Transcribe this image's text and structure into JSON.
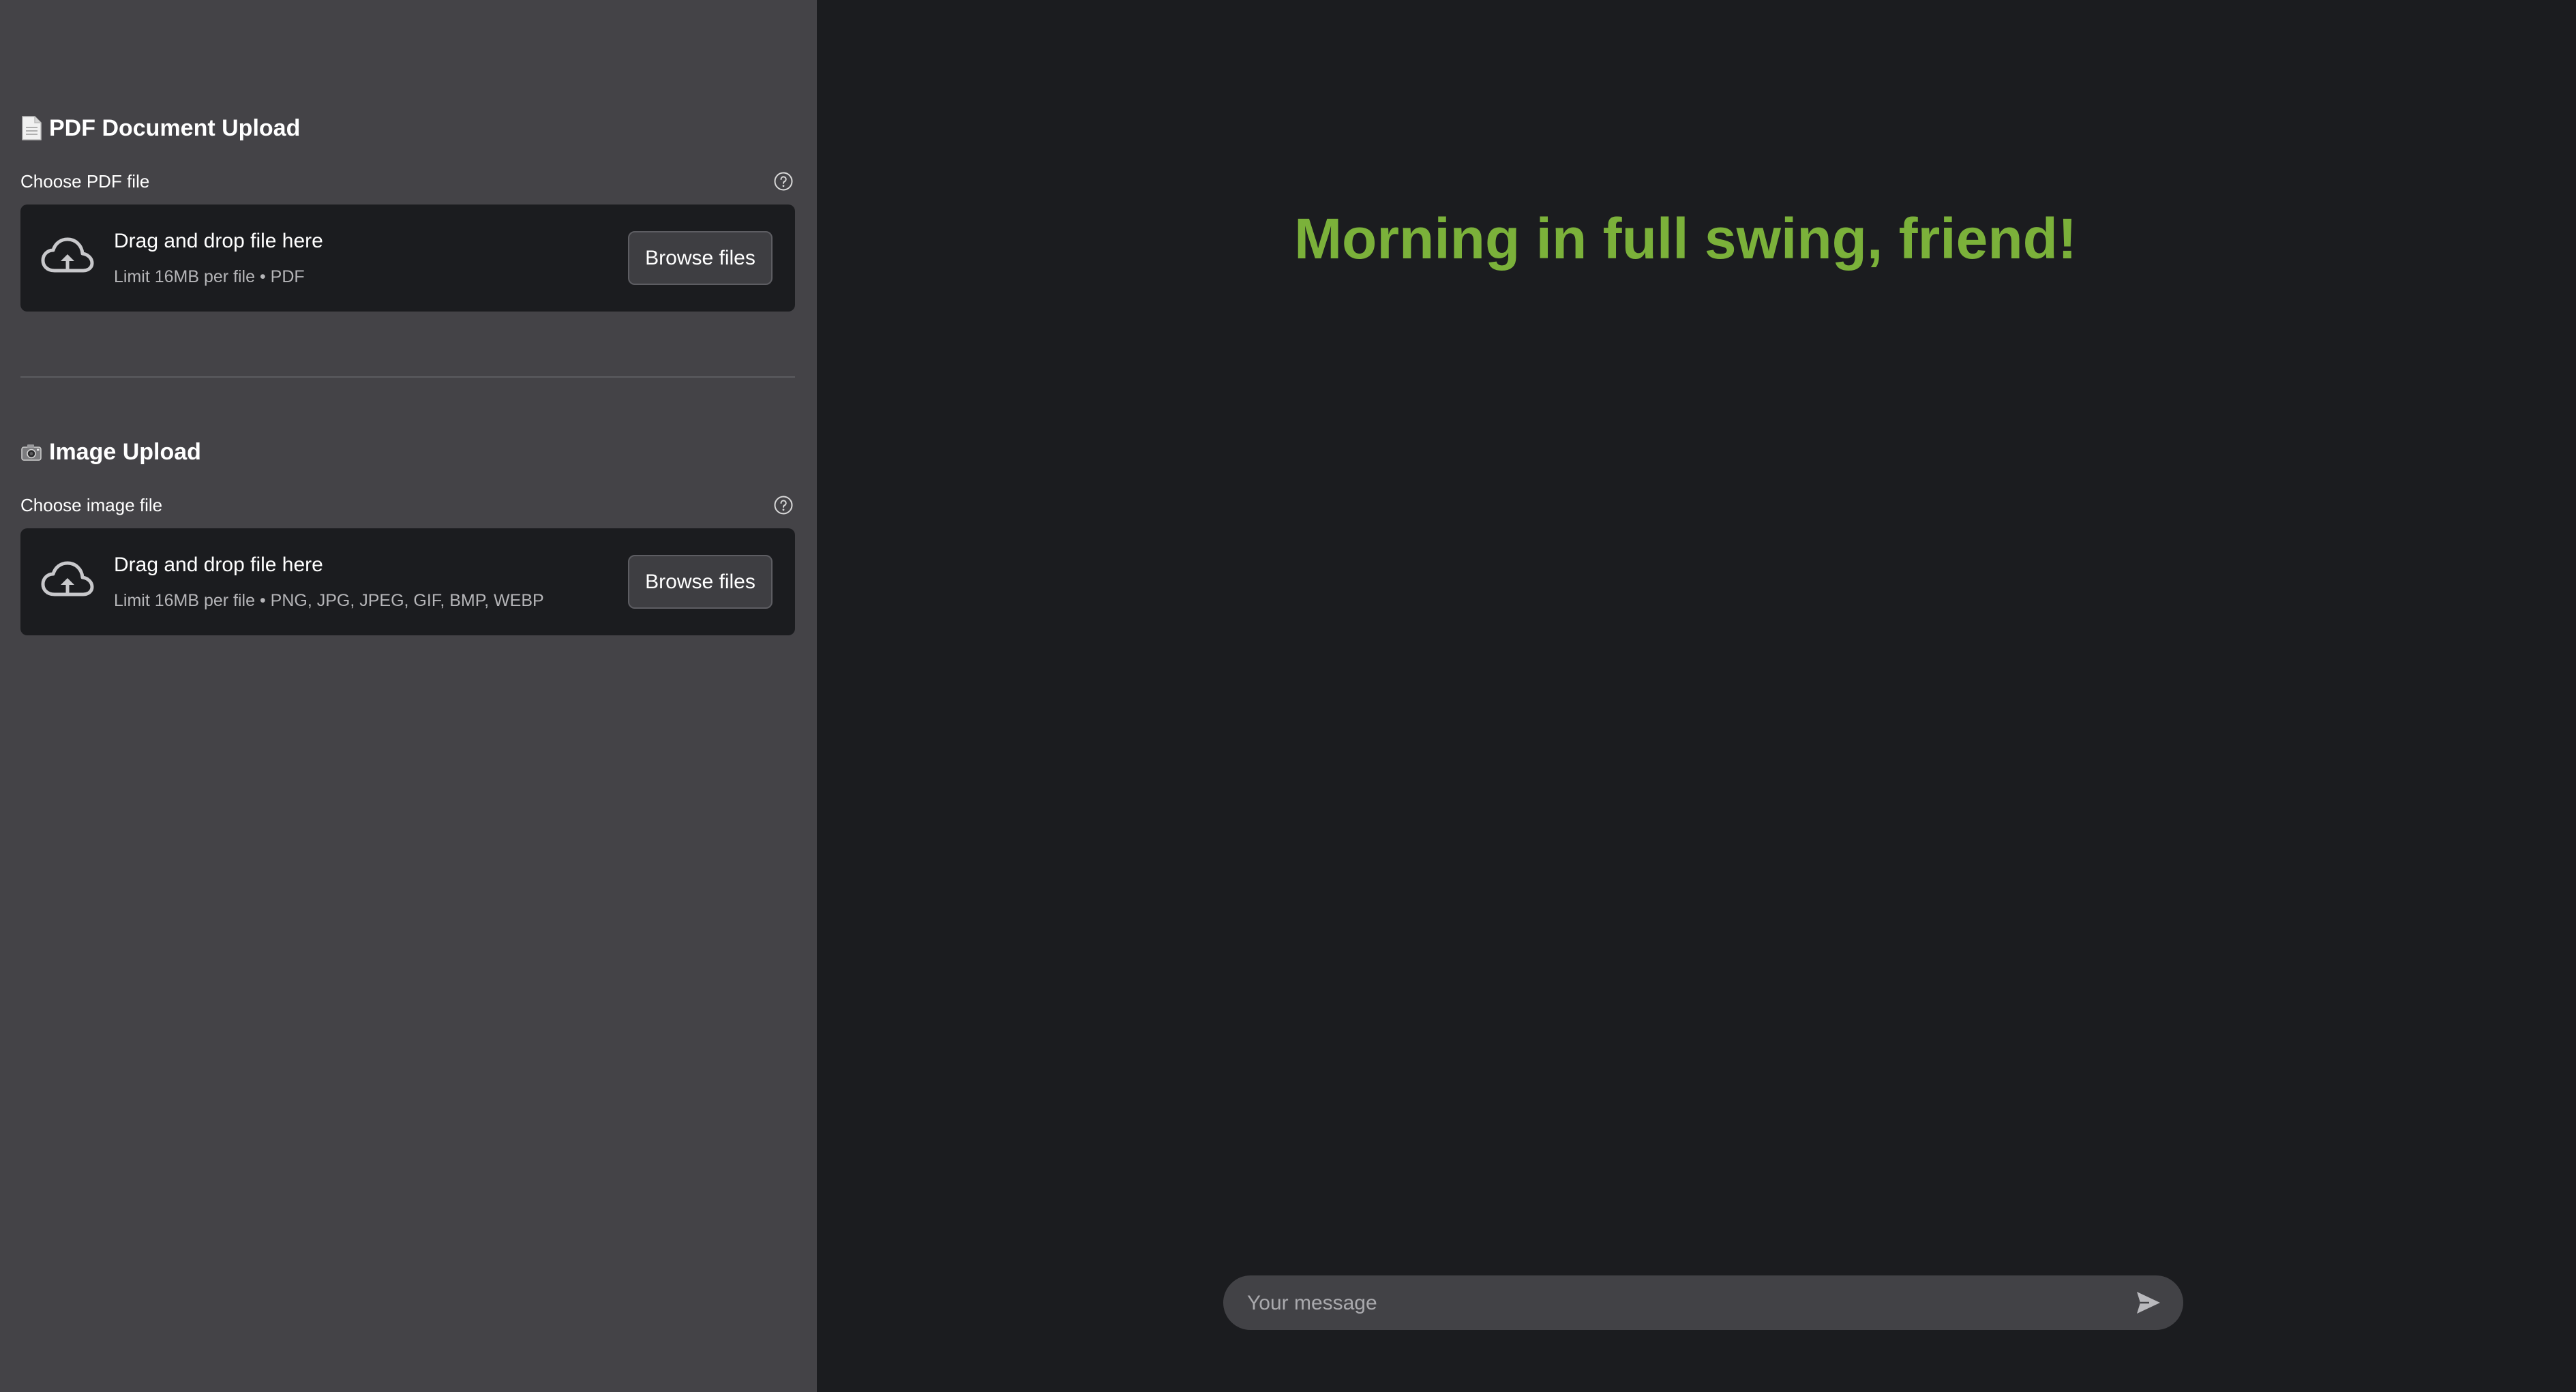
{
  "sidebar": {
    "pdf_section": {
      "icon": "page-document-icon",
      "title": "PDF Document Upload",
      "label": "Choose PDF file",
      "dropzone_title": "Drag and drop file here",
      "dropzone_limit": "Limit 16MB per file • PDF",
      "browse_label": "Browse files"
    },
    "image_section": {
      "icon": "camera-icon",
      "title": "Image Upload",
      "label": "Choose image file",
      "dropzone_title": "Drag and drop file here",
      "dropzone_limit": "Limit 16MB per file • PNG, JPG, JPEG, GIF, BMP, WEBP",
      "browse_label": "Browse files"
    }
  },
  "main": {
    "greeting": "Morning in full swing, friend!",
    "chat_placeholder": "Your message"
  },
  "colors": {
    "sidebar_bg": "#444347",
    "main_bg": "#1b1c1f",
    "greeting": "#7bb13a"
  }
}
